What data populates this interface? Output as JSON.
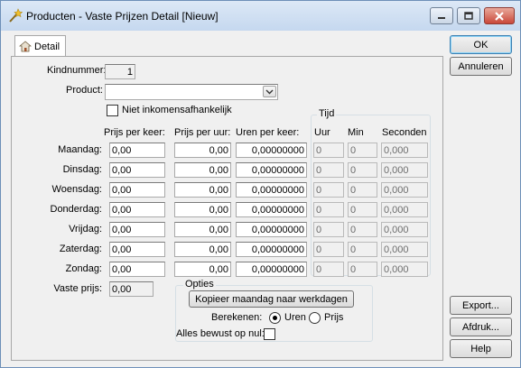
{
  "window": {
    "title": "Producten - Vaste Prijzen Detail [Nieuw]"
  },
  "tab": {
    "label": "Detail"
  },
  "form": {
    "kindnummer_label": "Kindnummer:",
    "kindnummer_value": "1",
    "product_label": "Product:",
    "product_value": "",
    "niet_label": "Niet inkomensafhankelijk",
    "niet_checked": false,
    "col_prijs_keer": "Prijs per keer:",
    "col_prijs_uur": "Prijs per uur:",
    "col_uren_keer": "Uren per keer:",
    "tijd_group": "Tijd",
    "col_uur": "Uur",
    "col_min": "Min",
    "col_seconden": "Seconden",
    "rows": [
      {
        "day": "Maandag:",
        "prijs_keer": "0,00",
        "prijs_uur": "0,00",
        "uren_keer": "0,00000000",
        "uur": "0",
        "min": "0",
        "sec": "0,000"
      },
      {
        "day": "Dinsdag:",
        "prijs_keer": "0,00",
        "prijs_uur": "0,00",
        "uren_keer": "0,00000000",
        "uur": "0",
        "min": "0",
        "sec": "0,000"
      },
      {
        "day": "Woensdag:",
        "prijs_keer": "0,00",
        "prijs_uur": "0,00",
        "uren_keer": "0,00000000",
        "uur": "0",
        "min": "0",
        "sec": "0,000"
      },
      {
        "day": "Donderdag:",
        "prijs_keer": "0,00",
        "prijs_uur": "0,00",
        "uren_keer": "0,00000000",
        "uur": "0",
        "min": "0",
        "sec": "0,000"
      },
      {
        "day": "Vrijdag:",
        "prijs_keer": "0,00",
        "prijs_uur": "0,00",
        "uren_keer": "0,00000000",
        "uur": "0",
        "min": "0",
        "sec": "0,000"
      },
      {
        "day": "Zaterdag:",
        "prijs_keer": "0,00",
        "prijs_uur": "0,00",
        "uren_keer": "0,00000000",
        "uur": "0",
        "min": "0",
        "sec": "0,000"
      },
      {
        "day": "Zondag:",
        "prijs_keer": "0,00",
        "prijs_uur": "0,00",
        "uren_keer": "0,00000000",
        "uur": "0",
        "min": "0",
        "sec": "0,000"
      }
    ],
    "vaste_prijs_label": "Vaste prijs:",
    "vaste_prijs_value": "0,00",
    "opties_group": "Opties",
    "kopieer_label": "Kopieer maandag naar werkdagen",
    "berekenen_label": "Berekenen:",
    "radio_uren": "Uren",
    "radio_prijs": "Prijs",
    "radio_selected": "uren",
    "alles_label": "Alles bewust op nul:",
    "alles_checked": false
  },
  "buttons": {
    "ok": "OK",
    "annuleren": "Annuleren",
    "export": "Export...",
    "afdruk": "Afdruk...",
    "help": "Help"
  },
  "icons": {
    "title": "wand-icon",
    "tab": "house-icon",
    "minimize": "minimize-icon",
    "maximize": "maximize-icon",
    "close": "close-icon",
    "dropdown": "chevron-down-icon"
  },
  "colors": {
    "titlebar": "#c5d8ef",
    "close_button": "#c9473a",
    "dialog_bg": "#f0f0f0"
  }
}
